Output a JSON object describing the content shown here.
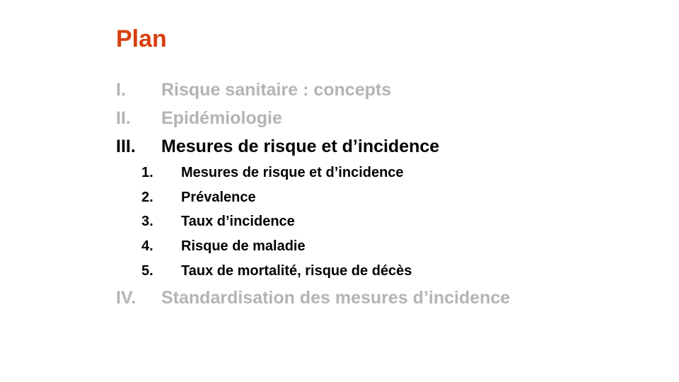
{
  "slide": {
    "title": "Plan",
    "title_color": "#d9400f",
    "muted_color": "#b4b4b4",
    "sections": [
      {
        "num": "I.",
        "text": "Risque sanitaire : concepts",
        "state": "muted"
      },
      {
        "num": "II.",
        "text": "Epidémiologie",
        "state": "muted"
      },
      {
        "num": "III.",
        "text": "Mesures de risque et d’incidence",
        "state": "active",
        "subitems": [
          {
            "num": "1.",
            "text": "Mesures de risque et d’incidence"
          },
          {
            "num": "2.",
            "text": "Prévalence"
          },
          {
            "num": "3.",
            "text": "Taux d’incidence"
          },
          {
            "num": "4.",
            "text": "Risque de maladie"
          },
          {
            "num": "5.",
            "text": "Taux de mortalité, risque de décès"
          }
        ]
      },
      {
        "num": "IV.",
        "text": "Standardisation des mesures d’incidence",
        "state": "muted"
      }
    ]
  }
}
